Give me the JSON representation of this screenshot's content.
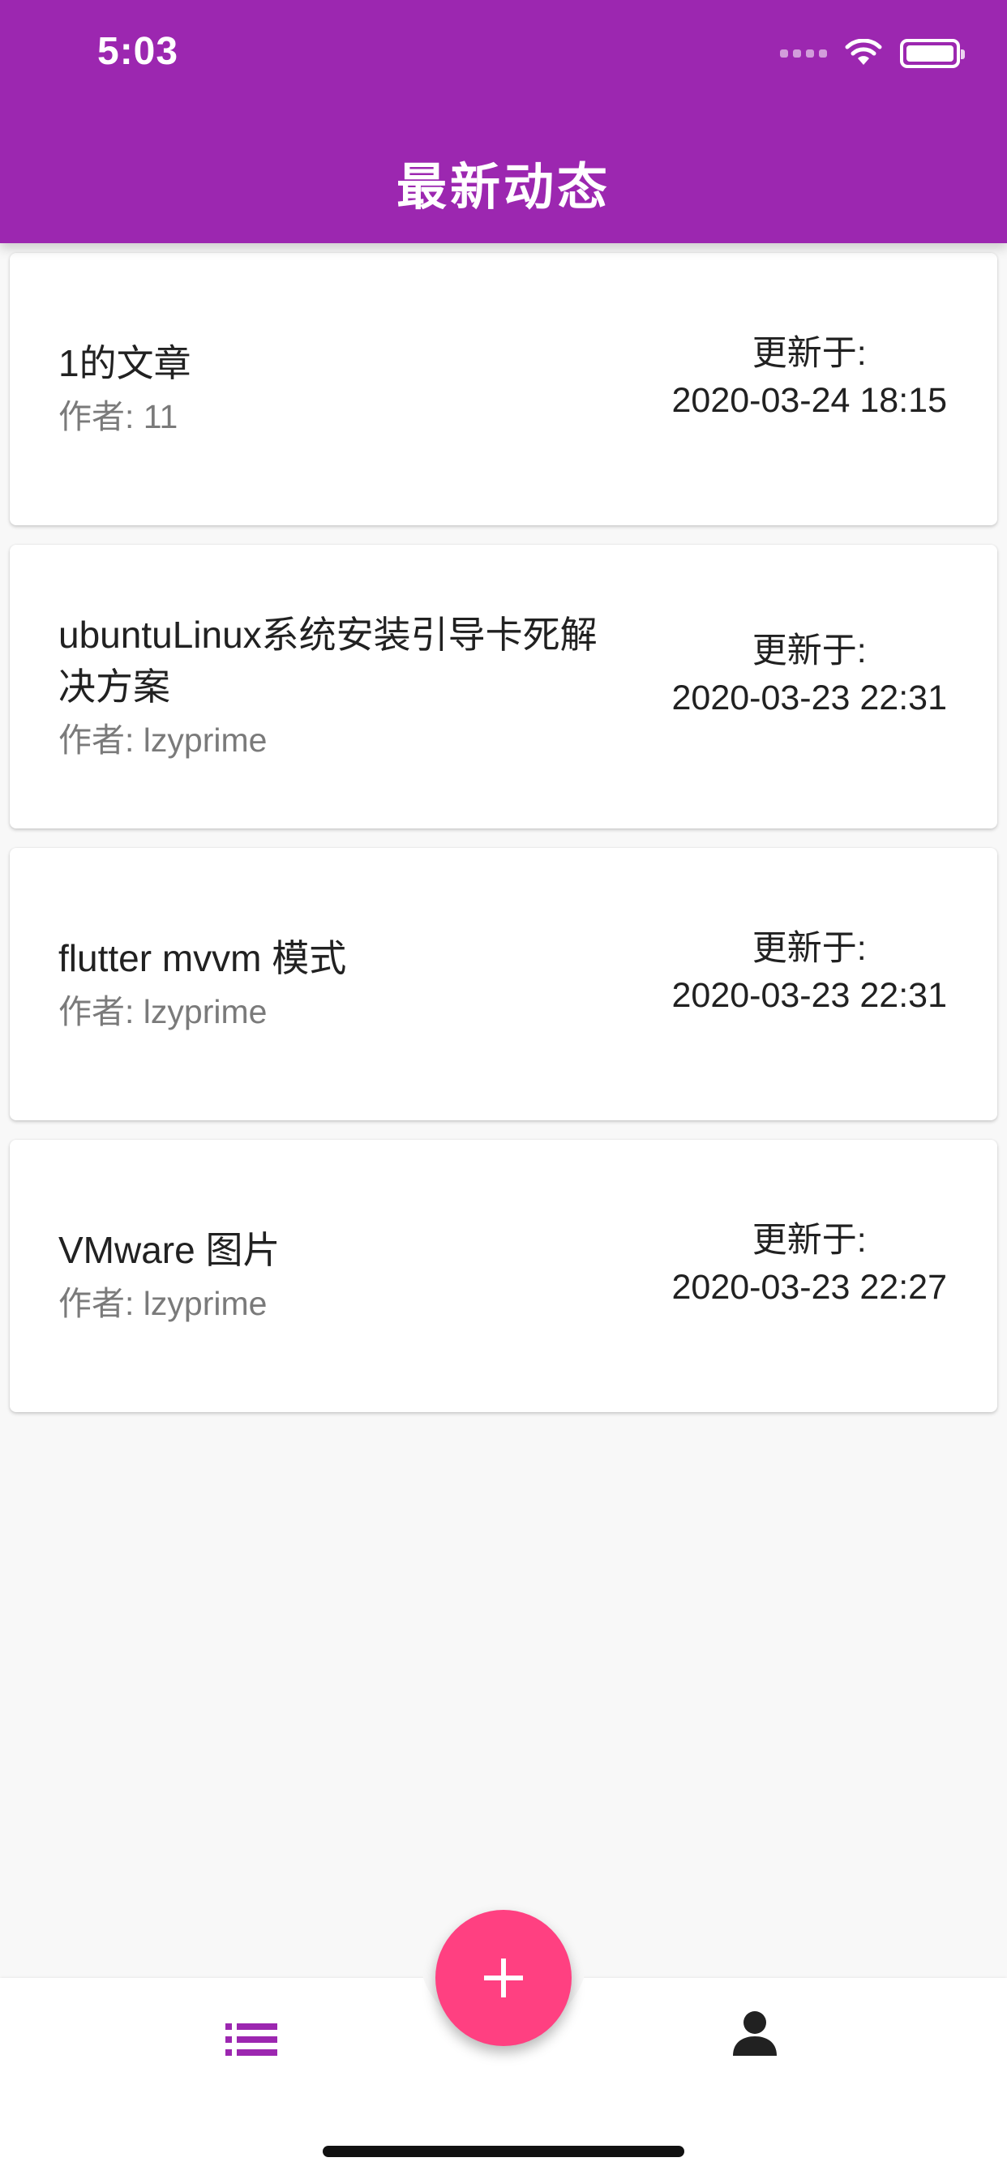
{
  "status_bar": {
    "time": "5:03"
  },
  "header": {
    "title": "最新动态"
  },
  "articles": [
    {
      "title": "1的文章",
      "author": "作者: 11",
      "updated_label": "更新于:",
      "updated_time": "2020-03-24 18:15"
    },
    {
      "title": "ubuntuLinux系统安装引导卡死解决方案",
      "author": "作者: lzyprime",
      "updated_label": "更新于:",
      "updated_time": "2020-03-23 22:31"
    },
    {
      "title": "flutter mvvm 模式",
      "author": "作者: lzyprime",
      "updated_label": "更新于:",
      "updated_time": "2020-03-23 22:31"
    },
    {
      "title": "VMware 图片",
      "author": "作者: lzyprime",
      "updated_label": "更新于:",
      "updated_time": "2020-03-23 22:27"
    }
  ],
  "bottom_nav": {
    "items": [
      {
        "icon": "list-icon",
        "active": true
      },
      {
        "icon": "person-icon",
        "active": false
      }
    ],
    "fab_icon": "plus-icon"
  },
  "colors": {
    "primary": "#9c27b0",
    "accent": "#ff4081",
    "background": "#f8f8f8",
    "card": "#ffffff",
    "title_text": "#212121",
    "secondary_text": "#7a7a7a"
  }
}
